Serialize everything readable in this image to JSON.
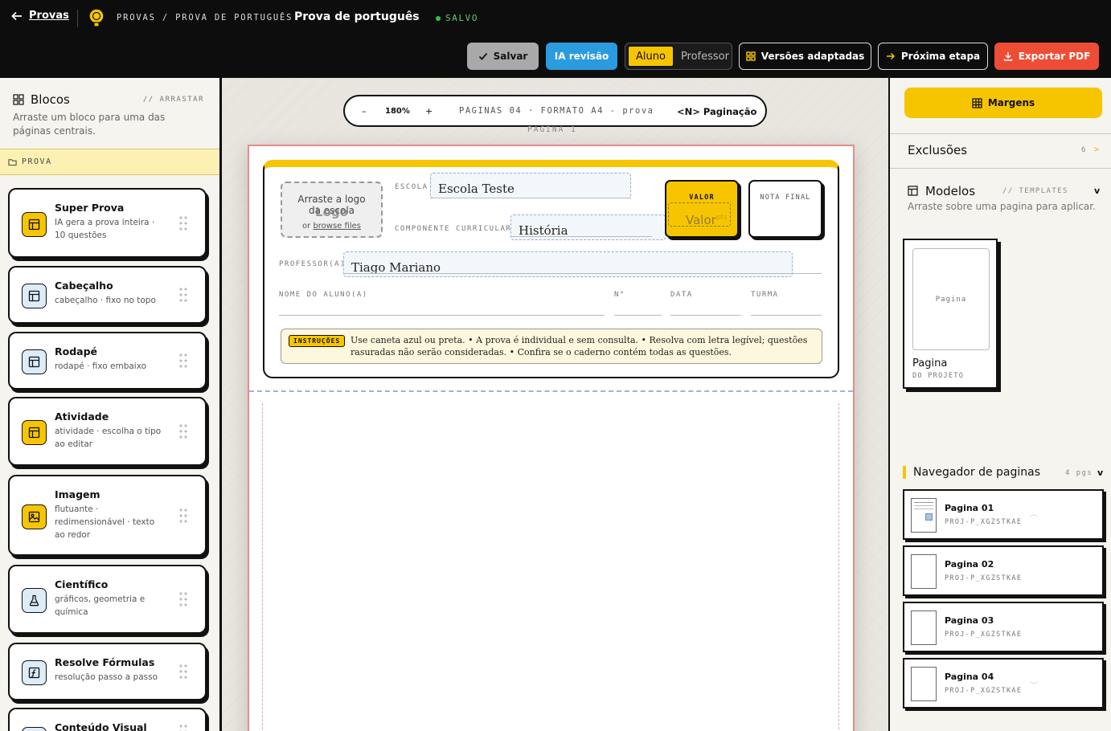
{
  "topbar": {
    "back_label": "Provas",
    "breadcrumb": "PROVAS / PROVA DE PORTUGUÊS",
    "doc_title": "Prova de português",
    "status": "SALVO",
    "save_label": "Salvar",
    "ia_label": "IA revisão",
    "mode_options": [
      "Aluno",
      "Professor"
    ],
    "mode_selected": "Aluno",
    "versoes_label": "Versões adaptadas",
    "proxima_label": "Próxima etapa",
    "export_label": "Exportar PDF",
    "colors": {
      "accent": "#f7c500",
      "ia": "#2b9be0",
      "export": "#ee4d35",
      "saved": "#2fbf4a"
    }
  },
  "left": {
    "title": "Blocos",
    "tag": "// ARRASTAR",
    "description": "Arraste um bloco para uma das páginas centrais.",
    "folder": "PROVA",
    "blocks": [
      {
        "title": "Super Prova",
        "desc": "IA gera a prova inteira · 10 questões",
        "icon": "layout-icon"
      },
      {
        "title": "Cabeçalho",
        "desc": "cabeçalho · fixo no topo",
        "icon": "layout-icon"
      },
      {
        "title": "Rodapé",
        "desc": "rodapé · fixo embaixo",
        "icon": "layout-icon"
      },
      {
        "title": "Atividade",
        "desc": "atividade · escolha o tipo ao editar",
        "icon": "layout-icon"
      },
      {
        "title": "Imagem",
        "desc": "flutuante · redimensionável · texto ao redor",
        "icon": "image-icon"
      },
      {
        "title": "Científico",
        "desc": "gráficos, geometria e química",
        "icon": "flask-icon"
      },
      {
        "title": "Resolve Fórmulas",
        "desc": "resolução passo a passo",
        "icon": "function-icon"
      },
      {
        "title": "Conteúdo Visual",
        "desc": "",
        "icon": "layout-icon"
      }
    ]
  },
  "canvas": {
    "zoom_out": "–",
    "zoom_level": "180%",
    "zoom_in": "+",
    "pages_info": "PAGINAS 04 · FORMATO A4 - prova",
    "pagination_label": "<N> Paginação",
    "page_label": "PAGINA 1",
    "header": {
      "logo_line1": "Arraste a logo",
      "logo_line2": "da escola",
      "logo_ghost": "Logo",
      "logo_or": "or",
      "logo_browse": "browse files",
      "escola_label": "ESCOLA",
      "escola_value": "Escola Teste",
      "componente_label": "COMPONENTE CURRICULAR",
      "componente_value": "História",
      "professor_label": "PROFESSOR(A)",
      "professor_value": "Tiago Mariano",
      "aluno_label": "NOME DO ALUNO(A)",
      "numero_label": "N°",
      "data_label": "DATA",
      "turma_label": "TURMA",
      "valor_label": "VALOR",
      "valor_placeholder": "Valor",
      "valor_unit": "pts",
      "nota_label": "NOTA FINAL",
      "instr_badge": "INSTRUÇÕES",
      "instr_text": "Use caneta azul ou preta. • A prova é individual e sem consulta. • Resolva com letra legível; questões rasuradas não serão consideradas. • Confira se o caderno contém todas as questões."
    }
  },
  "right": {
    "margens_label": "Margens",
    "exclusoes_title": "Exclusões",
    "exclusoes_count": "6",
    "exclusoes_arrow": ">",
    "modelos_title": "Modelos",
    "modelos_tag": "// TEMPLATES",
    "modelos_chevron": "v",
    "modelos_desc": "Arraste sobre uma pagina para aplicar.",
    "template": {
      "preview": "Pagina",
      "name": "Pagina",
      "sub": "DO PROJETO"
    },
    "nav_title": "Navegador de paginas",
    "nav_count": "4 pgs",
    "nav_chevron": "v",
    "pages": [
      {
        "title": "Pagina 01",
        "sub": "PROJ-P_XGZSTKAE"
      },
      {
        "title": "Pagina 02",
        "sub": "PROJ-P_XGZSTKAE"
      },
      {
        "title": "Pagina 03",
        "sub": "PROJ-P_XGZSTKAE"
      },
      {
        "title": "Pagina 04",
        "sub": "PROJ-P_XGZSTKAE"
      }
    ]
  }
}
